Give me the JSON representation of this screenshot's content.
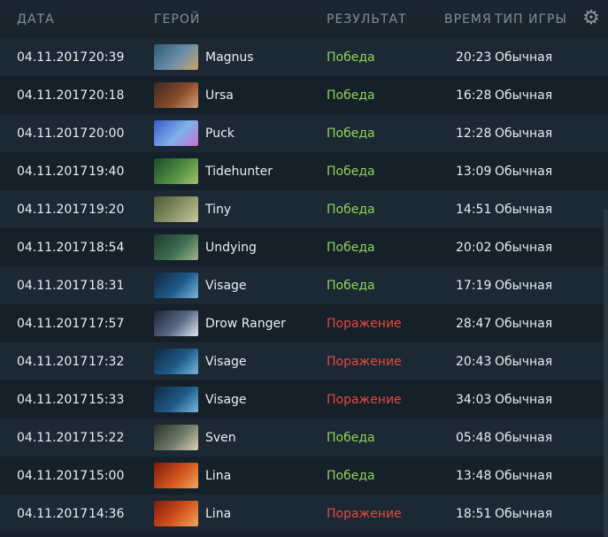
{
  "header": {
    "date": "ДАТА",
    "hero": "ГЕРОЙ",
    "result": "РЕЗУЛЬТАТ",
    "duration": "ВРЕМЯ",
    "game_type": "ТИП ИГРЫ",
    "settings_icon": "gear-icon"
  },
  "colors": {
    "win": "#8fd45a",
    "loss": "#e8483d",
    "background": "#17212b"
  },
  "matches": [
    {
      "date": "04.11.2017",
      "time": "20:39",
      "hero": "Magnus",
      "result": "Победа",
      "win": true,
      "duration": "20:23",
      "mode": "Обычная",
      "portrait": [
        "#2a5b7a",
        "#6d8fa8",
        "#c9a36a"
      ]
    },
    {
      "date": "04.11.2017",
      "time": "20:18",
      "hero": "Ursa",
      "result": "Победа",
      "win": true,
      "duration": "16:28",
      "mode": "Обычная",
      "portrait": [
        "#3a2a22",
        "#8a4a2c",
        "#d4a073"
      ]
    },
    {
      "date": "04.11.2017",
      "time": "20:00",
      "hero": "Puck",
      "result": "Победа",
      "win": true,
      "duration": "12:28",
      "mode": "Обычная",
      "portrait": [
        "#3b57c9",
        "#7fb2ea",
        "#c86fd2"
      ]
    },
    {
      "date": "04.11.2017",
      "time": "19:40",
      "hero": "Tidehunter",
      "result": "Победа",
      "win": true,
      "duration": "13:09",
      "mode": "Обычная",
      "portrait": [
        "#1f4a2a",
        "#4f8f43",
        "#a5c36a"
      ]
    },
    {
      "date": "04.11.2017",
      "time": "19:20",
      "hero": "Tiny",
      "result": "Победа",
      "win": true,
      "duration": "14:51",
      "mode": "Обычная",
      "portrait": [
        "#4c5a35",
        "#8c9467",
        "#c9c7a0"
      ]
    },
    {
      "date": "04.11.2017",
      "time": "18:54",
      "hero": "Undying",
      "result": "Победа",
      "win": true,
      "duration": "20:02",
      "mode": "Обычная",
      "portrait": [
        "#1d3b2d",
        "#3f6e52",
        "#9fb58c"
      ]
    },
    {
      "date": "04.11.2017",
      "time": "18:31",
      "hero": "Visage",
      "result": "Победа",
      "win": true,
      "duration": "17:19",
      "mode": "Обычная",
      "portrait": [
        "#0f2840",
        "#1f5a88",
        "#78b7dd"
      ]
    },
    {
      "date": "04.11.2017",
      "time": "17:57",
      "hero": "Drow Ranger",
      "result": "Поражение",
      "win": false,
      "duration": "28:47",
      "mode": "Обычная",
      "portrait": [
        "#1b2433",
        "#5b6a86",
        "#dfe6ef"
      ]
    },
    {
      "date": "04.11.2017",
      "time": "17:32",
      "hero": "Visage",
      "result": "Поражение",
      "win": false,
      "duration": "20:43",
      "mode": "Обычная",
      "portrait": [
        "#0f2840",
        "#1f5a88",
        "#78b7dd"
      ]
    },
    {
      "date": "04.11.2017",
      "time": "15:33",
      "hero": "Visage",
      "result": "Поражение",
      "win": false,
      "duration": "34:03",
      "mode": "Обычная",
      "portrait": [
        "#0f2840",
        "#1f5a88",
        "#78b7dd"
      ]
    },
    {
      "date": "04.11.2017",
      "time": "15:22",
      "hero": "Sven",
      "result": "Победа",
      "win": true,
      "duration": "05:48",
      "mode": "Обычная",
      "portrait": [
        "#2a2f2a",
        "#6f7a68",
        "#d9d2b0"
      ]
    },
    {
      "date": "04.11.2017",
      "time": "15:00",
      "hero": "Lina",
      "result": "Победа",
      "win": true,
      "duration": "13:48",
      "mode": "Обычная",
      "portrait": [
        "#7a1c0c",
        "#d4541e",
        "#f2a65a"
      ]
    },
    {
      "date": "04.11.2017",
      "time": "14:36",
      "hero": "Lina",
      "result": "Поражение",
      "win": false,
      "duration": "18:51",
      "mode": "Обычная",
      "portrait": [
        "#7a1c0c",
        "#d4541e",
        "#f2a65a"
      ]
    }
  ]
}
